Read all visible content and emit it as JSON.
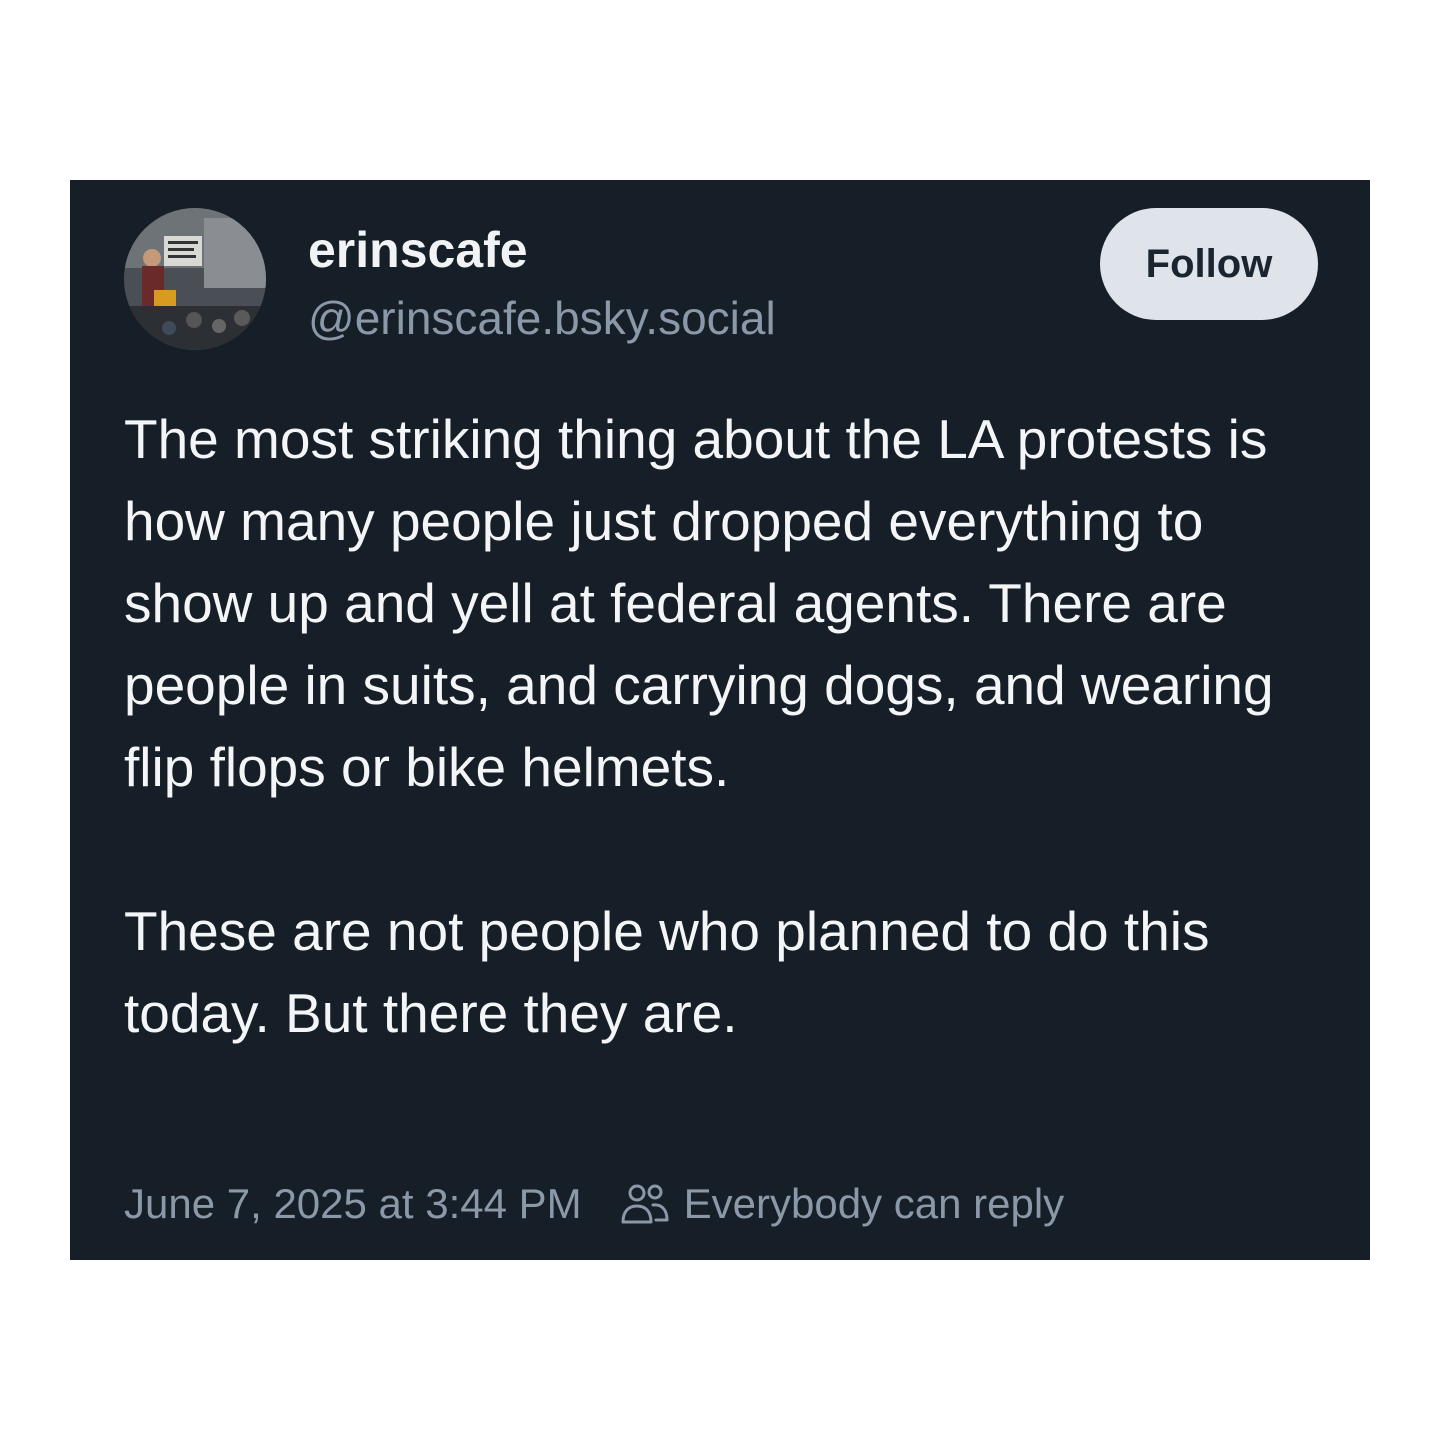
{
  "post": {
    "author": {
      "display_name": "erinscafe",
      "handle": "@erinscafe.bsky.social",
      "avatar": "avatar-photo"
    },
    "follow_label": "Follow",
    "paragraphs": [
      "The most striking thing about the LA protests is how many people just dropped everything to show up and yell at federal agents. There are people in suits, and carrying dogs, and wearing flip flops or bike helmets.",
      "These are not people who planned to do this today. But there they are."
    ],
    "timestamp": "June 7, 2025 at 3:44 PM",
    "reply_setting": {
      "icon": "people-icon",
      "label": "Everybody can reply"
    },
    "colors": {
      "card_background": "#161e27",
      "text": "#f3f5f7",
      "muted_text": "#8b98a8",
      "follow_button": "#dfe4ea"
    }
  }
}
